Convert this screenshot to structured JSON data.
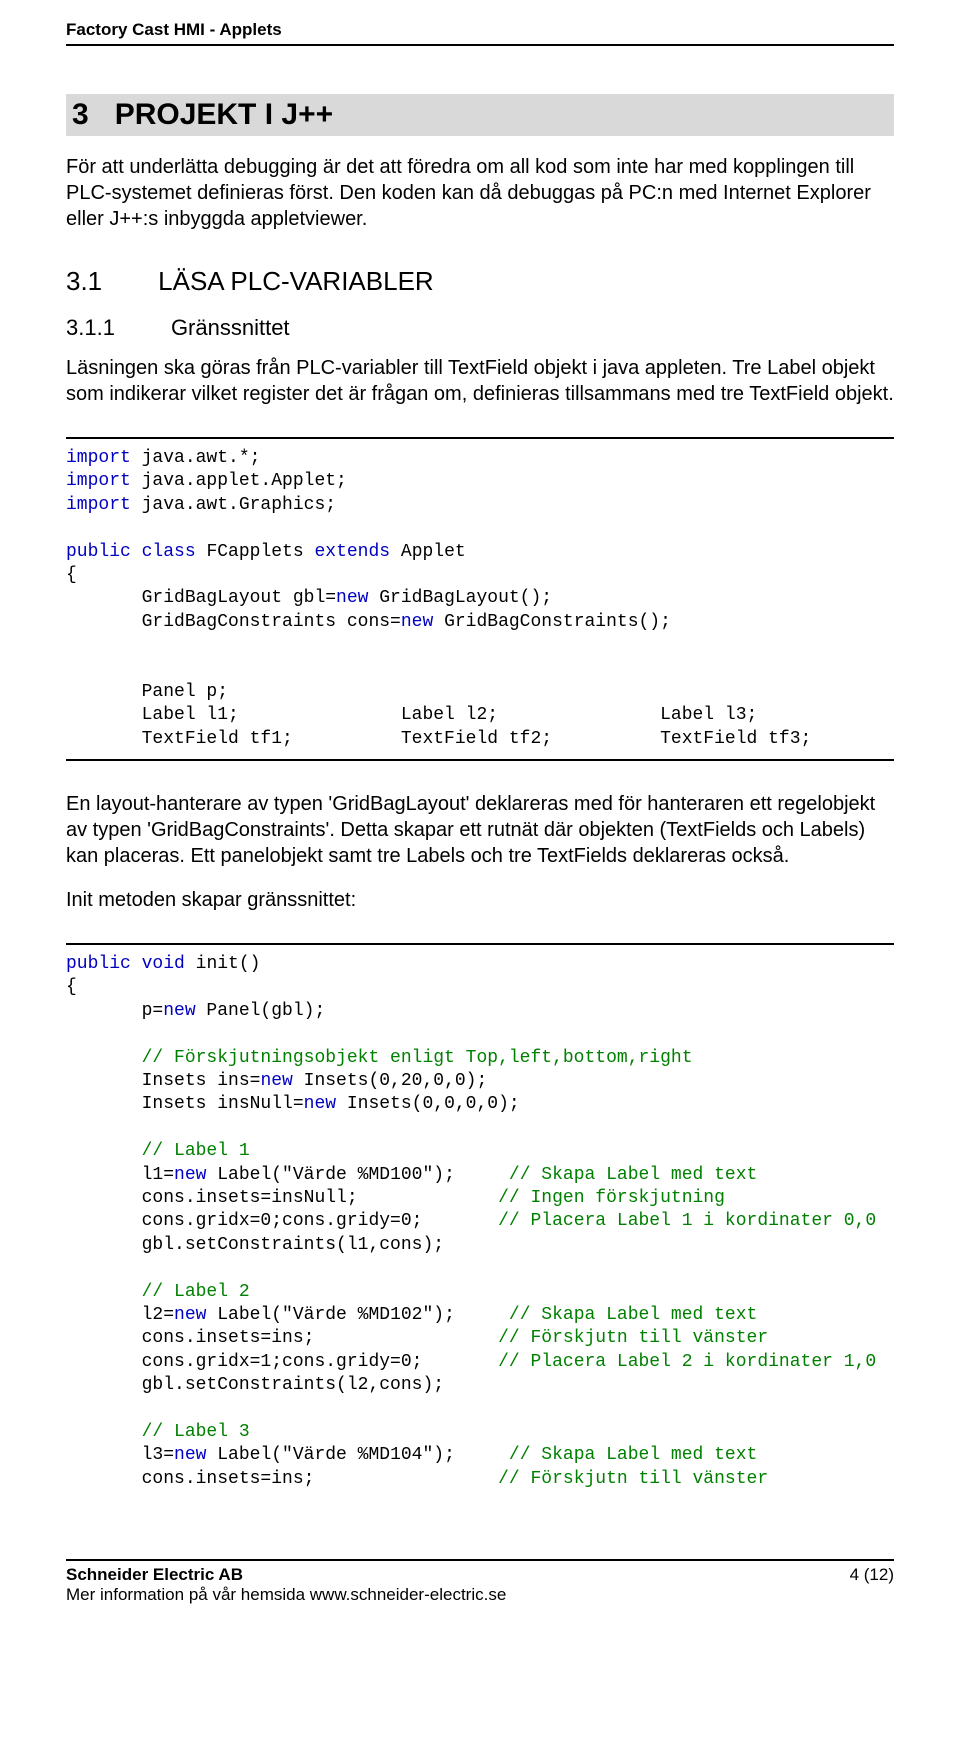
{
  "header": {
    "title": "Factory Cast HMI - Applets"
  },
  "section": {
    "num": "3",
    "title": "PROJEKT I J++",
    "intro1": "För att underlätta debugging är det att föredra om all kod som inte har med kopplingen till PLC-systemet definieras först. Den koden kan då debuggas på PC:n med Internet Explorer eller J++:s inbyggda appletviewer."
  },
  "h2": {
    "num": "3.1",
    "title": "LÄSA PLC-VARIABLER"
  },
  "h3": {
    "num": "3.1.1",
    "title": "Gränssnittet",
    "text": "Läsningen ska göras från PLC-variabler till TextField objekt i java appleten. Tre Label objekt som indikerar vilket register det är frågan om, definieras tillsammans med tre TextField objekt."
  },
  "code1": {
    "l1a": "import",
    "l1b": " java.awt.*;",
    "l2a": "import",
    "l2b": " java.applet.Applet;",
    "l3a": "import",
    "l3b": " java.awt.Graphics;",
    "l4": "",
    "l5a": "public",
    "l5b": " ",
    "l5c": "class",
    "l5d": " FCapplets ",
    "l5e": "extends",
    "l5f": " Applet",
    "l6": "{",
    "l7a": "       GridBagLayout gbl=",
    "l7b": "new",
    "l7c": " GridBagLayout();",
    "l8a": "       GridBagConstraints cons=",
    "l8b": "new",
    "l8c": " GridBagConstraints();",
    "l9": "",
    "l10": "",
    "l11": "       Panel p;",
    "l12": "       Label l1;               Label l2;               Label l3;",
    "l13": "       TextField tf1;          TextField tf2;          TextField tf3;"
  },
  "para2": "En layout-hanterare av typen 'GridBagLayout' deklareras med för hanteraren ett regelobjekt av typen 'GridBagConstraints'. Detta skapar ett rutnät där objekten (TextFields och Labels) kan placeras. Ett panelobjekt samt tre Labels och tre TextFields deklareras också.",
  "para3": "Init metoden skapar gränssnittet:",
  "code2": {
    "l1a": "public",
    "l1b": " ",
    "l1c": "void",
    "l1d": " init()",
    "l2": "{",
    "l3a": "       p=",
    "l3b": "new",
    "l3c": " Panel(gbl);",
    "l4": "",
    "l5": "       // Förskjutningsobjekt enligt Top,left,bottom,right",
    "l6a": "       Insets ins=",
    "l6b": "new",
    "l6c": " Insets(0,20,0,0);",
    "l7a": "       Insets insNull=",
    "l7b": "new",
    "l7c": " Insets(0,0,0,0);",
    "l8": "",
    "l9": "       // Label 1",
    "l10a": "       l1=",
    "l10b": "new",
    "l10c": " Label(\"Värde %MD100\");     ",
    "l10d": "// Skapa Label med text",
    "l11a": "       cons.insets=insNull;             ",
    "l11b": "// Ingen förskjutning",
    "l12a": "       cons.gridx=0;cons.gridy=0;       ",
    "l12b": "// Placera Label 1 i kordinater 0,0",
    "l13": "       gbl.setConstraints(l1,cons);",
    "l14": "",
    "l15": "       // Label 2",
    "l16a": "       l2=",
    "l16b": "new",
    "l16c": " Label(\"Värde %MD102\");     ",
    "l16d": "// Skapa Label med text",
    "l17a": "       cons.insets=ins;                 ",
    "l17b": "// Förskjutn till vänster",
    "l18a": "       cons.gridx=1;cons.gridy=0;       ",
    "l18b": "// Placera Label 2 i kordinater 1,0",
    "l19": "       gbl.setConstraints(l2,cons);",
    "l20": "",
    "l21": "       // Label 3",
    "l22a": "       l3=",
    "l22b": "new",
    "l22c": " Label(\"Värde %MD104\");     ",
    "l22d": "// Skapa Label med text",
    "l23a": "       cons.insets=ins;                 ",
    "l23b": "// Förskjutn till vänster"
  },
  "footer": {
    "company": "Schneider Electric AB",
    "info": "Mer information på vår hemsida www.schneider-electric.se",
    "pageno": "4 (12)"
  }
}
